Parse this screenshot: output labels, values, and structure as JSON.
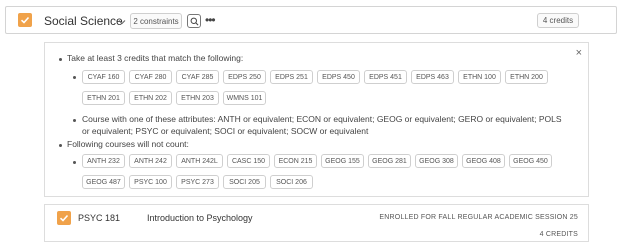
{
  "requirement": {
    "title": "Social Science",
    "constraints_label": "2 constraints",
    "more_label": "•••",
    "credits_label": "4 credits"
  },
  "constraints": {
    "close_label": "×",
    "intro": "Take at least 3 credits that match the following:",
    "course_chips_row1": [
      "CYAF 160",
      "CYAF 280",
      "CYAF 285",
      "EDPS 250",
      "EDPS 251",
      "EDPS 450",
      "EDPS 451",
      "EDPS 463",
      "ETHN 100",
      "ETHN 200"
    ],
    "course_chips_row2": [
      "ETHN 201",
      "ETHN 202",
      "ETHN 203",
      "WMNS 101"
    ],
    "attributes_line1": "Course with one of these attributes: ANTH or equivalent; ECON or equivalent; GEOG or equivalent; GERO or equivalent; POLS",
    "attributes_line2": "or equivalent; PSYC or equivalent; SOCI or equivalent; SOCW or equivalent",
    "excluded_intro": "Following courses will not count:",
    "excluded_row1": [
      "ANTH 232",
      "ANTH 242",
      "ANTH 242L",
      "CASC 150",
      "ECON 215",
      "GEOG 155",
      "GEOG 281",
      "GEOG 308",
      "GEOG 408",
      "GEOG 450"
    ],
    "excluded_row2": [
      "GEOG 487",
      "PSYC 100",
      "PSYC 273",
      "SOCI 205",
      "SOCI 206"
    ]
  },
  "course": {
    "code": "PSYC 181",
    "name": "Introduction to Psychology",
    "status": "ENROLLED FOR FALL REGULAR ACADEMIC SESSION 25",
    "credits": "4 CREDITS"
  },
  "colors": {
    "checkbox": "#f0a24a",
    "border": "#d4d4d4"
  }
}
